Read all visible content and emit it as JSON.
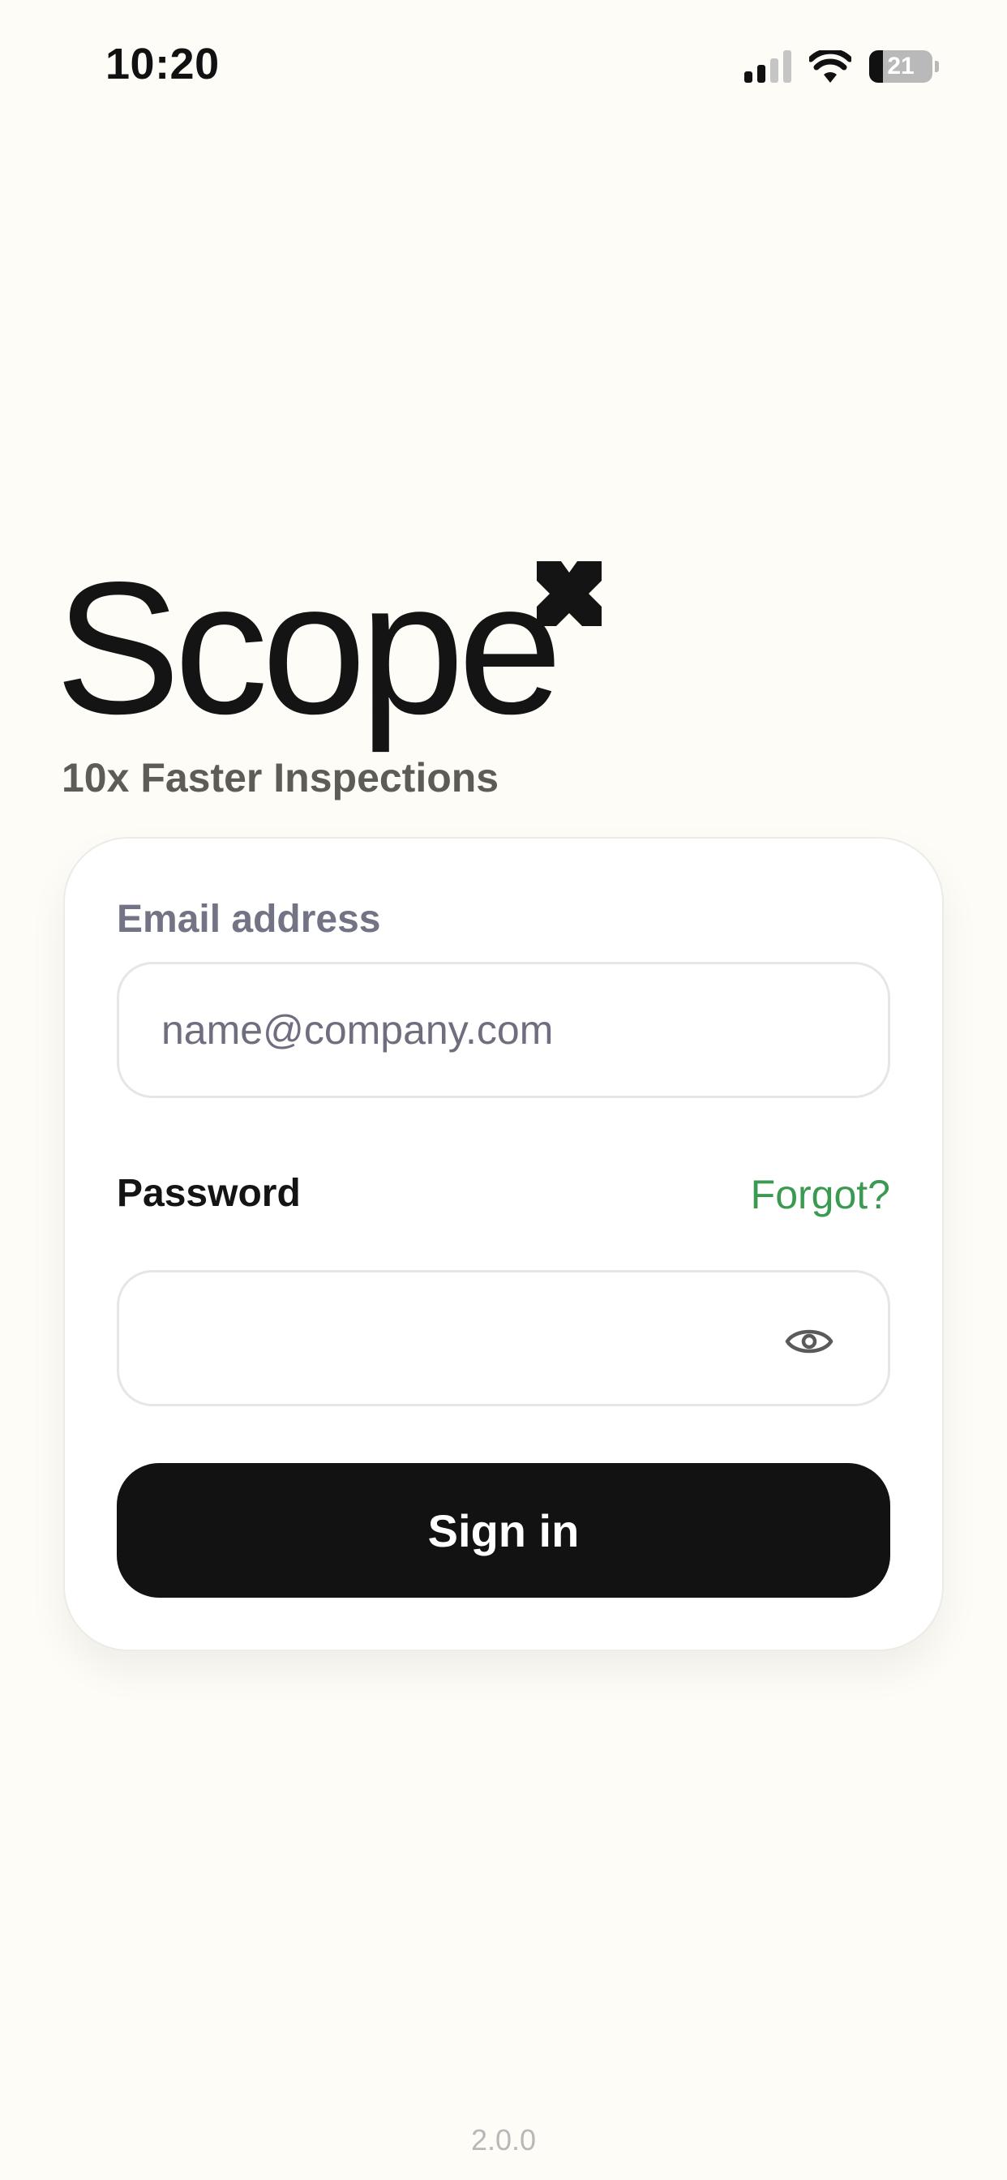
{
  "status_bar": {
    "time": "10:20",
    "battery_level": "21",
    "icons": [
      "cellular-signal-icon",
      "wifi-icon",
      "battery-icon"
    ]
  },
  "brand": {
    "name": "Scope",
    "logo_mark": "x-logo-icon",
    "tagline": "10x Faster Inspections"
  },
  "login_form": {
    "email_label": "Email address",
    "email_placeholder": "name@company.com",
    "email_value": "",
    "password_label": "Password",
    "password_value": "",
    "forgot_label": "Forgot?",
    "show_password_icon": "eye-icon",
    "submit_label": "Sign in"
  },
  "footer": {
    "version": "2.0.0"
  },
  "colors": {
    "background": "#fdfcf7",
    "card": "#ffffff",
    "accent_green": "#3a9a52",
    "button": "#121212",
    "muted_label": "#737386"
  }
}
